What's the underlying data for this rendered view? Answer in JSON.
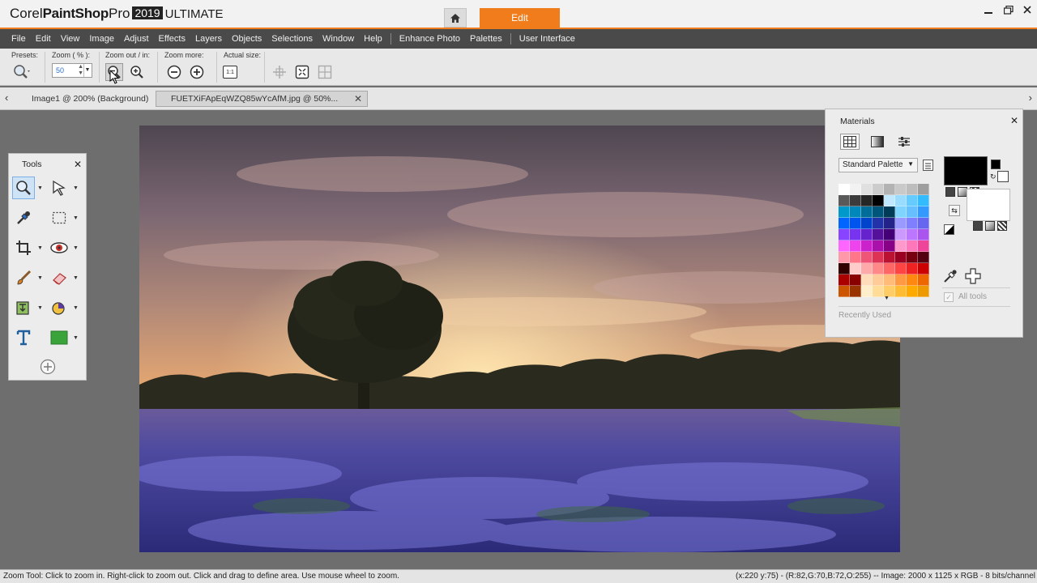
{
  "app": {
    "brand_corel": "Corel",
    "brand_psp": "PaintShop",
    "brand_pro": "Pro",
    "brand_year": "2019",
    "brand_edition": "ULTIMATE",
    "edit_tab": "Edit",
    "accent_color": "#f07c1c"
  },
  "menu": [
    "File",
    "Edit",
    "View",
    "Image",
    "Adjust",
    "Effects",
    "Layers",
    "Objects",
    "Selections",
    "Window",
    "Help",
    "Enhance Photo",
    "Palettes",
    "User Interface"
  ],
  "options": {
    "presets_label": "Presets:",
    "zoom_label": "Zoom ( % ):",
    "zoom_value": "50",
    "zoom_out_in_label": "Zoom out / in:",
    "zoom_more_label": "Zoom more:",
    "actual_size_label": "Actual size:",
    "actual_size_icon_text": "1:1"
  },
  "tabs": [
    {
      "label": "Image1 @ 200% (Background)",
      "active": false
    },
    {
      "label": "FUETXiFApEqWZQ85wYcAfM.jpg  @   50%...",
      "active": true
    }
  ],
  "tools_palette": {
    "title": "Tools"
  },
  "materials": {
    "title": "Materials",
    "palette_dropdown": "Standard Palette",
    "all_tools": "All tools",
    "recently_used": "Recently Used",
    "foreground_color": "#000000",
    "background_color": "#ffffff",
    "swatch_colors": [
      "#ffffff",
      "#f2f2f2",
      "#e0e0e0",
      "#cccccc",
      "#b3b3b3",
      "#c9c9c9",
      "#bdbdbd",
      "#9e9e9e",
      "#5a5a5a",
      "#3c3c3c",
      "#262626",
      "#000000",
      "#bfe8ff",
      "#99dcff",
      "#66ccff",
      "#33bbff",
      "#0099cc",
      "#0088bb",
      "#006d99",
      "#00557a",
      "#003c57",
      "#7fd4ff",
      "#66bfff",
      "#3399ff",
      "#0066ff",
      "#0055ee",
      "#0044cc",
      "#2233aa",
      "#222288",
      "#9999ff",
      "#8080ff",
      "#6666ee",
      "#8844ff",
      "#7733ee",
      "#6622cc",
      "#551199",
      "#440077",
      "#cc99ff",
      "#bb77ff",
      "#aa55ee",
      "#ff66ff",
      "#ee44ee",
      "#cc22cc",
      "#aa11aa",
      "#880088",
      "#ff99cc",
      "#ff77bb",
      "#ee4499",
      "#ff99aa",
      "#ff7788",
      "#ee5577",
      "#dd3355",
      "#bb1133",
      "#990022",
      "#770011",
      "#550011",
      "#330000",
      "#ffcccc",
      "#ffaaaa",
      "#ff8888",
      "#ff6666",
      "#ff4444",
      "#ee2222",
      "#cc0000",
      "#aa0000",
      "#880000",
      "#ffddbb",
      "#ffcc99",
      "#ffbb77",
      "#ff9944",
      "#ff8811",
      "#ee6600",
      "#cc5500",
      "#993300",
      "#ffeecc",
      "#ffdd99",
      "#ffcc66",
      "#ffbb33",
      "#ffaa00",
      "#ee9900"
    ]
  },
  "status": {
    "hint": "Zoom Tool: Click to zoom in. Right-click to zoom out. Click and drag to define area. Use mouse wheel to zoom.",
    "info": "(x:220 y:75) - (R:82,G:70,B:72,O:255) -- Image:  2000 x 1125 x RGB - 8 bits/channel"
  }
}
